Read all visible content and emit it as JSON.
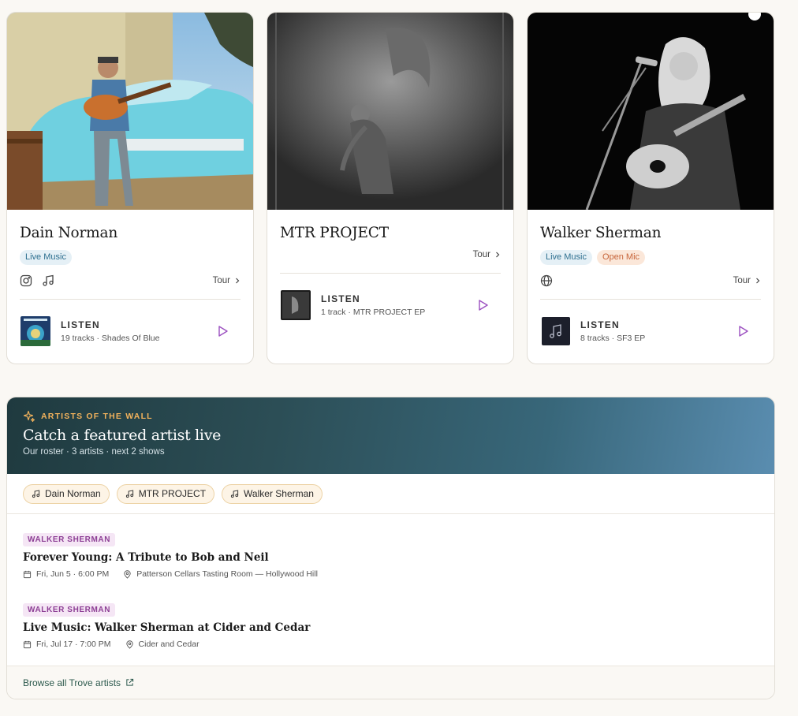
{
  "cards": [
    {
      "name": "Dain Norman",
      "tags": [
        "Live Music"
      ],
      "tour_label": "Tour",
      "listen_label": "LISTEN",
      "listen_sub": "19 tracks · Shades Of Blue"
    },
    {
      "name": "MTR PROJECT",
      "tags": [],
      "tour_label": "Tour",
      "listen_label": "LISTEN",
      "listen_sub": "1 track · MTR PROJECT EP"
    },
    {
      "name": "Walker Sherman",
      "tags": [
        "Live Music",
        "Open Mic"
      ],
      "tour_label": "Tour",
      "listen_label": "LISTEN",
      "listen_sub": "8 tracks · SF3 EP"
    }
  ],
  "featured": {
    "eyebrow": "ARTISTS OF THE WALL",
    "title": "Catch a featured artist live",
    "subtitle": "Our roster · 3 artists · next 2 shows",
    "chips": [
      "Dain Norman",
      "MTR PROJECT",
      "Walker Sherman"
    ],
    "events": [
      {
        "artist": "WALKER SHERMAN",
        "title": "Forever Young: A Tribute to Bob and Neil",
        "date": "Fri, Jun 5 · 6:00 PM",
        "venue": "Patterson Cellars Tasting Room — Hollywood Hill"
      },
      {
        "artist": "WALKER SHERMAN",
        "title": "Live Music: Walker Sherman at Cider and Cedar",
        "date": "Fri, Jul 17 · 7:00 PM",
        "venue": "Cider and Cedar"
      }
    ],
    "footer_link": "Browse all Trove artists"
  },
  "colors": {
    "accent_play": "#9b4fc0",
    "eyebrow": "#f2b25c",
    "chip_border": "#edd3a6",
    "footer_link": "#2d5a4e"
  },
  "icons": {
    "card1": [
      "instagram-icon",
      "music-note-icon"
    ],
    "card3": [
      "globe-icon"
    ],
    "play": "play-icon",
    "tour": "chevron-right-icon",
    "eyebrow": "sparkle-icon",
    "calendar": "calendar-icon",
    "location": "map-pin-icon",
    "external": "external-link-icon"
  }
}
